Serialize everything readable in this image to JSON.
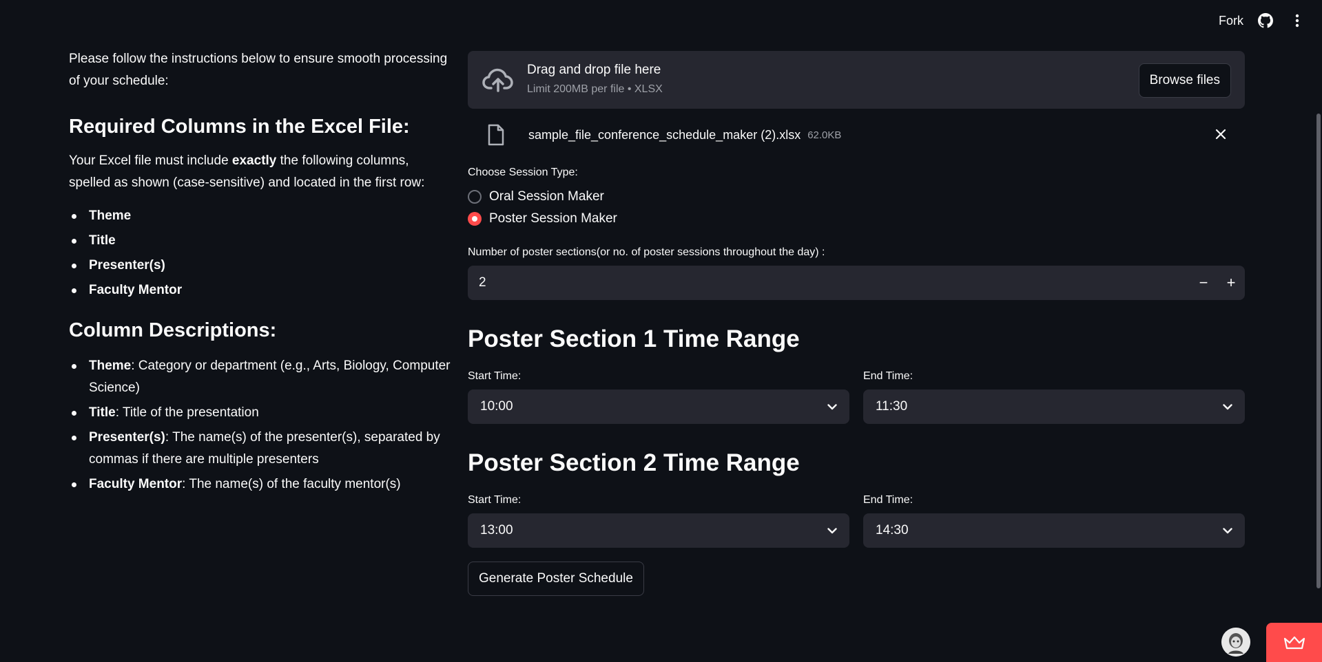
{
  "header": {
    "fork_label": "Fork",
    "icons": [
      "github-icon",
      "more-vertical-icon"
    ]
  },
  "instructions": {
    "intro": "Please follow the instructions below to ensure smooth processing of your schedule:",
    "required_heading": "Required Columns in the Excel File:",
    "required_text_before": "Your Excel file must include ",
    "required_text_bold": "exactly",
    "required_text_after": " the following columns, spelled as shown (case-sensitive) and located in the first row:",
    "required_columns": [
      "Theme",
      "Title",
      "Presenter(s)",
      "Faculty Mentor"
    ],
    "descriptions_heading": "Column Descriptions:",
    "descriptions": [
      {
        "term": "Theme",
        "text": ": Category or department (e.g., Arts, Biology, Computer Science)"
      },
      {
        "term": "Title",
        "text": ": Title of the presentation"
      },
      {
        "term": "Presenter(s)",
        "text": ": The name(s) of the presenter(s), separated by commas if there are multiple presenters"
      },
      {
        "term": "Faculty Mentor",
        "text": ": The name(s) of the faculty mentor(s)"
      }
    ]
  },
  "uploader": {
    "title": "Drag and drop file here",
    "limit": "Limit 200MB per file • XLSX",
    "browse_label": "Browse files",
    "file_name": "sample_file_conference_schedule_maker (2).xlsx",
    "file_size": "62.0KB"
  },
  "session_type": {
    "label": "Choose Session Type:",
    "options": [
      "Oral Session Maker",
      "Poster Session Maker"
    ],
    "selected": "Poster Session Maker"
  },
  "poster_sections": {
    "label": "Number of poster sections(or no. of poster sessions throughout the day) :",
    "value": "2",
    "minus": "−",
    "plus": "+"
  },
  "sections": [
    {
      "heading": "Poster Section 1 Time Range",
      "start_label": "Start Time:",
      "start": "10:00",
      "end_label": "End Time:",
      "end": "11:30"
    },
    {
      "heading": "Poster Section 2 Time Range",
      "start_label": "Start Time:",
      "start": "13:00",
      "end_label": "End Time:",
      "end": "14:30"
    }
  ],
  "generate_label": "Generate Poster Schedule",
  "colors": {
    "background": "#0e1117",
    "widget": "#262730",
    "accent": "#ff4b4b",
    "text": "#fafafa"
  }
}
